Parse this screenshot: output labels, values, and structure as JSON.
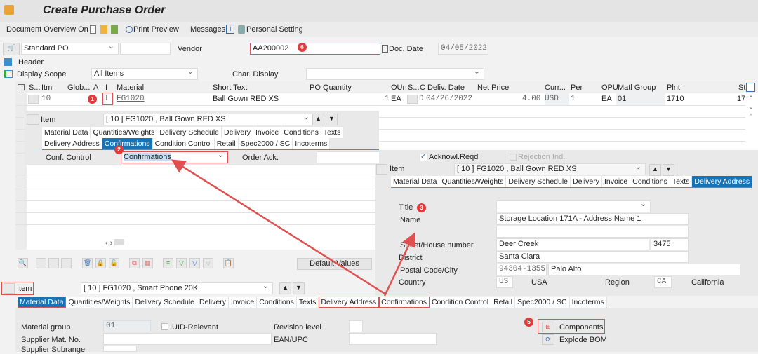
{
  "app": {
    "title": "Create Purchase Order"
  },
  "toolbar": {
    "doc_overview": "Document Overview On",
    "print_preview": "Print Preview",
    "messages": "Messages",
    "personal_setting": "Personal Setting"
  },
  "header": {
    "doc_type": "Standard PO",
    "vendor_label": "Vendor",
    "vendor_value": "AA200002",
    "doc_date_label": "Doc. Date",
    "doc_date_value": "04/05/2022",
    "header_label": "Header",
    "display_scope_label": "Display Scope",
    "display_scope_value": "All Items",
    "char_display_label": "Char. Display",
    "char_display_value": ""
  },
  "table": {
    "columns": [
      "S...",
      "Itm",
      "Glob...",
      "A",
      "I",
      "Material",
      "Short Text",
      "PO Quantity",
      "OUn",
      "S...",
      "C",
      "Deliv. Date",
      "Net Price",
      "Curr...",
      "Per",
      "OPU",
      "Matl Group",
      "Plnt",
      "St"
    ],
    "row": {
      "itm": "10",
      "i": "L",
      "material": "FG1020",
      "short_text": "Ball Gown RED XS",
      "po_qty": "1",
      "oun": "EA",
      "c": "D",
      "deliv_date": "04/26/2022",
      "net_price": "4.00",
      "curr": "USD",
      "per": "1",
      "opu": "EA",
      "matl_group": "01",
      "plnt": "1710",
      "st": "17"
    }
  },
  "item_panel_1": {
    "item_label": "Item",
    "item_value": "[ 10 ] FG1020 , Ball Gown RED XS",
    "tabs": [
      "Material Data",
      "Quantities/Weights",
      "Delivery Schedule",
      "Delivery",
      "Invoice",
      "Conditions",
      "Texts",
      "Delivery Address",
      "Confirmations",
      "Condition Control",
      "Retail",
      "Spec2000 / SC",
      "Incoterms"
    ],
    "active_tab": "Confirmations",
    "conf_control_label": "Conf. Control",
    "conf_control_value": "Confirmations",
    "order_ack_label": "Order Ack.",
    "order_ack_value": "",
    "ack_reqd_label": "Acknowl.Reqd",
    "ack_reqd_checked": true,
    "rejection_label": "Rejection Ind.",
    "rejection_checked": false
  },
  "item_panel_2": {
    "item_label": "Item",
    "item_value": "[ 10 ] FG1020 , Ball Gown RED XS",
    "tabs": [
      "Material Data",
      "Quantities/Weights",
      "Delivery Schedule",
      "Delivery",
      "Invoice",
      "Conditions",
      "Texts",
      "Delivery Address"
    ],
    "active_tab": "Delivery Address",
    "title_label": "Title",
    "title_value": "",
    "name_label": "Name",
    "name_value": "Storage Location 171A - Address Name 1",
    "name2_value": "",
    "street_label": "Street/House number",
    "street_value": "Deer Creek",
    "house_value": "3475",
    "district_label": "District",
    "district_value": "Santa Clara",
    "postal_label": "Postal Code/City",
    "postal_value": "94304-1355",
    "city_value": "Palo Alto",
    "country_label": "Country",
    "country_code": "US",
    "country_name": "USA",
    "region_label": "Region",
    "region_code": "CA",
    "region_name": "California"
  },
  "bottom": {
    "default_values": "Default Values",
    "item_label": "Item",
    "item_value": "[ 10 ] FG1020 , Smart Phone 20K",
    "tabs": [
      "Material Data",
      "Quantities/Weights",
      "Delivery Schedule",
      "Delivery",
      "Invoice",
      "Conditions",
      "Texts",
      "Delivery Address",
      "Confirmations",
      "Condition Control",
      "Retail",
      "Spec2000 / SC",
      "Incoterms"
    ],
    "active_tab": "Material Data",
    "boxed_tabs": [
      "Material Data",
      "Delivery Address",
      "Confirmations"
    ],
    "material_group_label": "Material group",
    "material_group_value": "01",
    "iuid_label": "IUID-Relevant",
    "revision_label": "Revision level",
    "supplier_mat_label": "Supplier Mat. No.",
    "ean_label": "EAN/UPC",
    "supplier_subrange_label": "Supplier Subrange",
    "components": "Components",
    "explode_bom": "Explode BOM"
  },
  "annotations": {
    "b1": "1",
    "b2": "2",
    "b3": "3",
    "b5": "5",
    "b6": "6"
  },
  "colors": {
    "accent": "#1873b4",
    "annotation": "#e03c3c"
  }
}
